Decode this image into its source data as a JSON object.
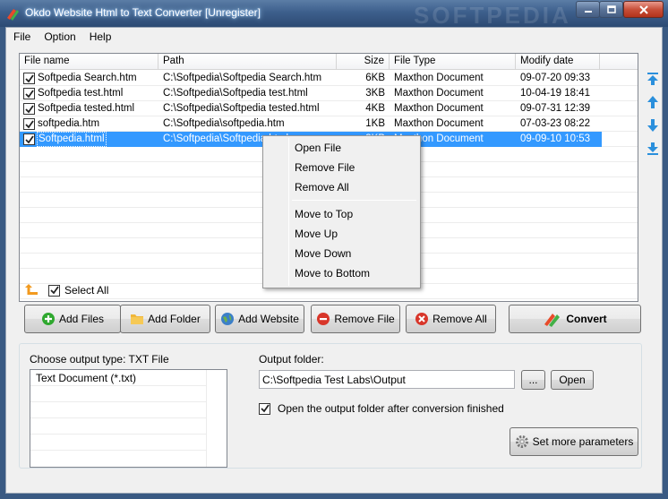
{
  "window": {
    "title": "Okdo Website Html to Text Converter [Unregister]",
    "watermark": "SOFTPEDIA"
  },
  "menu": [
    "File",
    "Option",
    "Help"
  ],
  "file_list": {
    "columns": [
      "File name",
      "Path",
      "Size",
      "File Type",
      "Modify date"
    ],
    "rows": [
      {
        "checked": true,
        "name": "Softpedia Search.htm",
        "path": "C:\\Softpedia\\Softpedia Search.htm",
        "size": "6KB",
        "type": "Maxthon Document",
        "date": "09-07-20 09:33",
        "selected": false
      },
      {
        "checked": true,
        "name": "Softpedia test.html",
        "path": "C:\\Softpedia\\Softpedia test.html",
        "size": "3KB",
        "type": "Maxthon Document",
        "date": "10-04-19 18:41",
        "selected": false
      },
      {
        "checked": true,
        "name": "Softpedia tested.html",
        "path": "C:\\Softpedia\\Softpedia tested.html",
        "size": "4KB",
        "type": "Maxthon Document",
        "date": "09-07-31 12:39",
        "selected": false
      },
      {
        "checked": true,
        "name": "softpedia.htm",
        "path": "C:\\Softpedia\\softpedia.htm",
        "size": "1KB",
        "type": "Maxthon Document",
        "date": "07-03-23 08:22",
        "selected": false
      },
      {
        "checked": true,
        "name": "Softpedia.html",
        "path": "C:\\Softpedia\\Softpedia.html",
        "size": "3KB",
        "type": "Maxthon Document",
        "date": "09-09-10 10:53",
        "selected": true
      }
    ]
  },
  "context_menu": {
    "items": [
      "Open File",
      "Remove File",
      "Remove All"
    ],
    "items2": [
      "Move to Top",
      "Move Up",
      "Move Down",
      "Move to Bottom"
    ]
  },
  "select_all": {
    "label": "Select All",
    "checked": true
  },
  "buttons": {
    "add_files": "Add Files",
    "add_folder": "Add Folder",
    "add_website": "Add Website",
    "remove_file": "Remove File",
    "remove_all": "Remove All",
    "convert": "Convert",
    "browse": "...",
    "open": "Open",
    "more_params": "Set more parameters"
  },
  "output": {
    "type_label": "Choose output type:  TXT File",
    "types": [
      "Text Document (*.txt)"
    ],
    "folder_label": "Output folder:",
    "folder_value": "C:\\Softpedia Test Labs\\Output",
    "open_after_label": "Open the output folder after conversion finished",
    "open_after_checked": true
  },
  "colors": {
    "selection": "#3399ff",
    "title_glow": "#bfe0ff",
    "arrow_blue": "#2a8fdc",
    "add_green": "#2fa82f",
    "remove_red": "#d8362a"
  }
}
